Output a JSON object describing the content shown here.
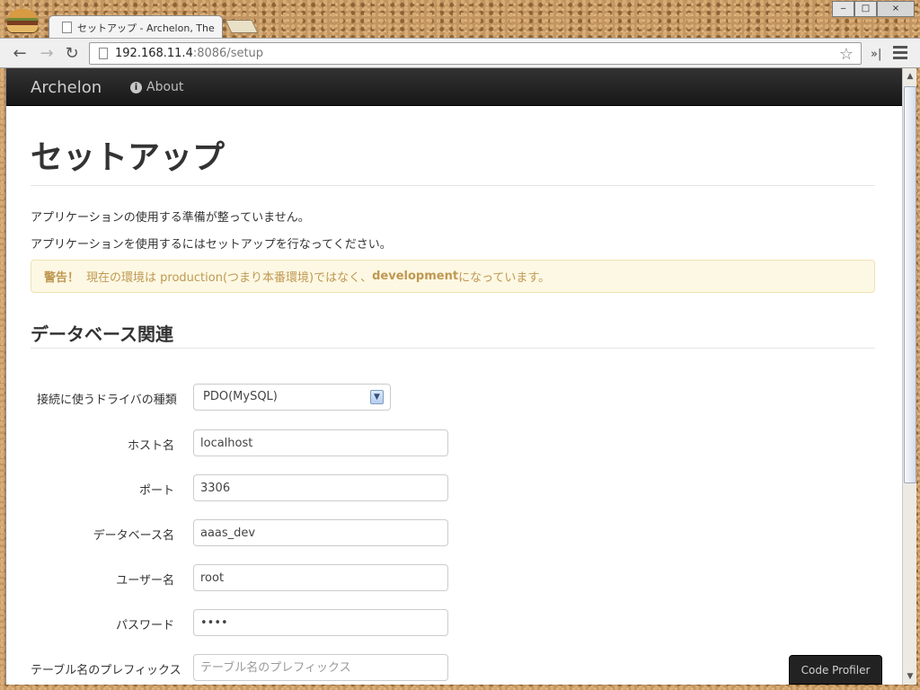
{
  "browser": {
    "tab_title": "セットアップ - Archelon, The",
    "url_host": "192.168.11.4",
    "url_rest": ":8086/setup",
    "window_controls": {
      "minimize": "‒",
      "maximize": "□",
      "close": "×"
    },
    "icons": [
      "back-icon",
      "forward-icon",
      "reload-icon",
      "star-icon",
      "extensions-icon",
      "menu-icon"
    ]
  },
  "navbar": {
    "brand": "Archelon",
    "about": "About"
  },
  "page": {
    "title": "セットアップ",
    "intro_1": "アプリケーションの使用する準備が整っていません。",
    "intro_2": "アプリケーションを使用するにはセットアップを行なってください。",
    "alert": {
      "label": "警告！",
      "text_before": "現在の環境は production(つまり本番環境)ではなく、",
      "env": "development",
      "text_after": "になっています。"
    },
    "section_title": "データベース関連"
  },
  "form": {
    "driver_label": "接続に使うドライバの種類",
    "driver_value": "PDO(MySQL)",
    "host_label": "ホスト名",
    "host_value": "localhost",
    "port_label": "ポート",
    "port_value": "3306",
    "database_label": "データベース名",
    "database_value": "aaas_dev",
    "user_label": "ユーザー名",
    "user_value": "root",
    "password_label": "パスワード",
    "password_value": "••••",
    "prefix_label": "テーブル名のプレフィックス",
    "prefix_placeholder": "テーブル名のプレフィックス"
  },
  "profiler": {
    "label": "Code Profiler"
  },
  "colors": {
    "navbar": "#1b1b1b",
    "alert_background": "#fcf8e3",
    "alert_text": "#c09853",
    "text": "#333333"
  }
}
